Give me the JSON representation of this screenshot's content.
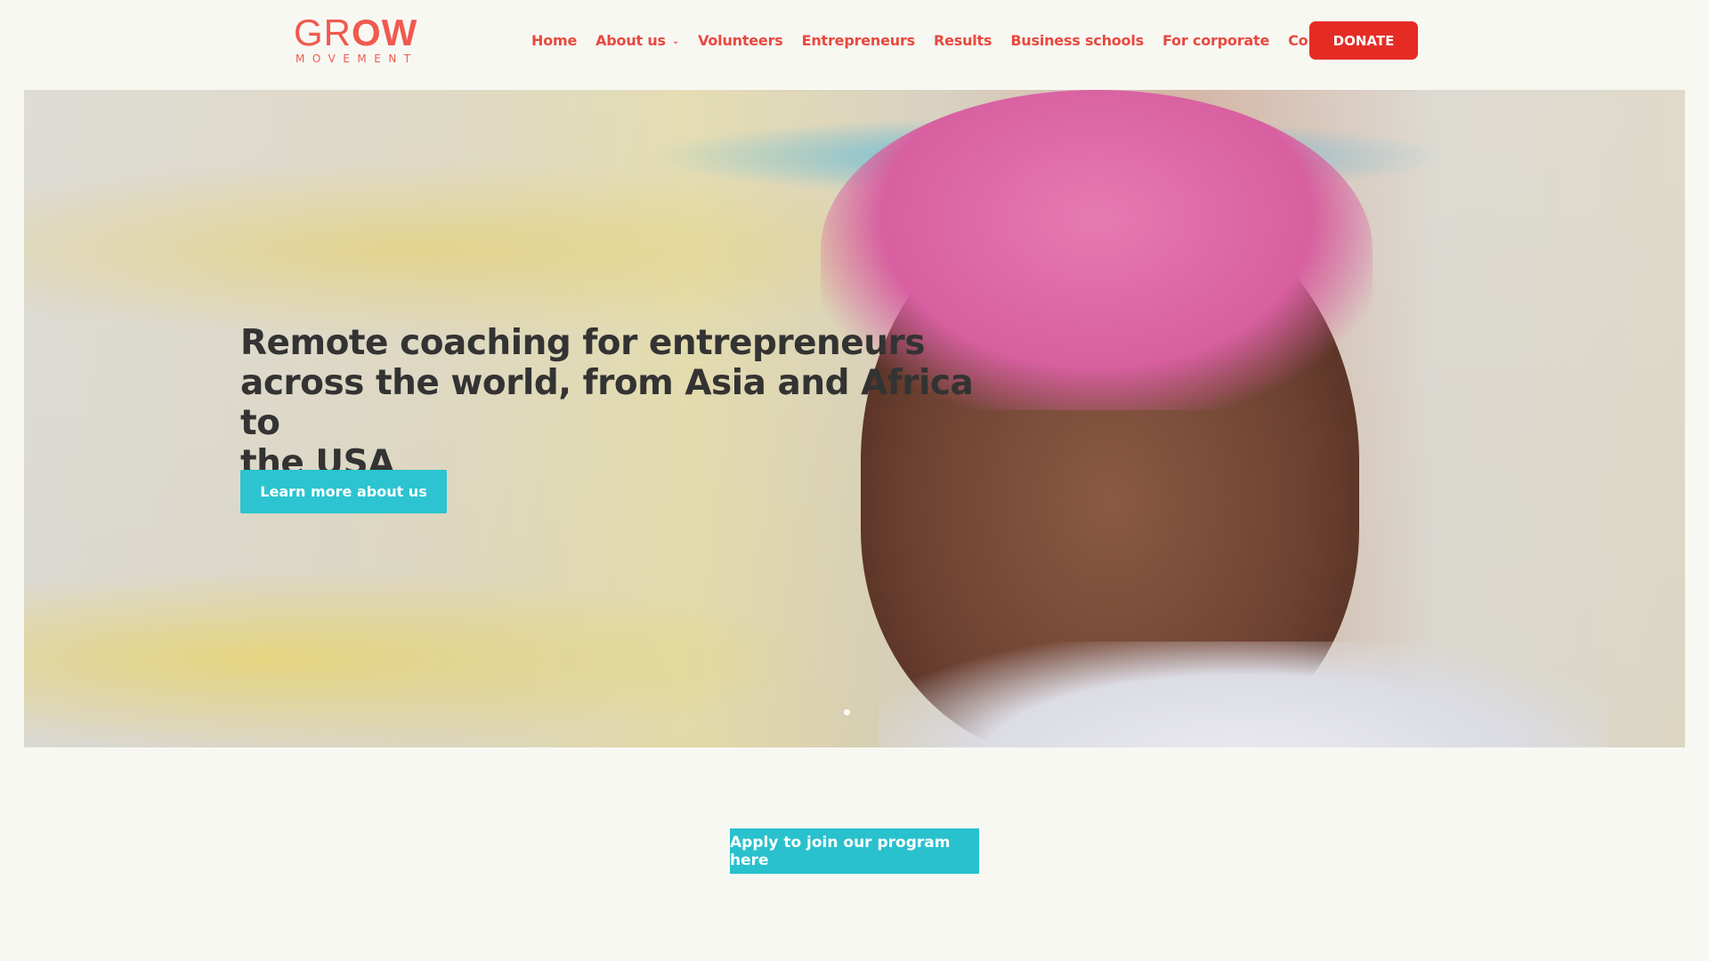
{
  "brand": {
    "logo_word": "GROW",
    "logo_sub": "MOVEMENT",
    "accent_color": "#f05a4e",
    "donate_color": "#e42c25",
    "cta_color": "#2bc4d0"
  },
  "nav": {
    "items": [
      {
        "label": "Home"
      },
      {
        "label": "About us",
        "has_dropdown": true
      },
      {
        "label": "Volunteers"
      },
      {
        "label": "Entrepreneurs"
      },
      {
        "label": "Results"
      },
      {
        "label": "Business schools"
      },
      {
        "label": "For corporate"
      },
      {
        "label": "Contact us"
      }
    ],
    "donate_label": "DONATE"
  },
  "hero": {
    "title_lines": [
      "Remote coaching for entrepreneurs",
      "across the world, from Asia and Africa to",
      "the USA"
    ],
    "button_label": "Learn more about us",
    "slide_indicator_icon": "dot-icon"
  },
  "main": {
    "apply_label": "Apply to join our program here"
  }
}
